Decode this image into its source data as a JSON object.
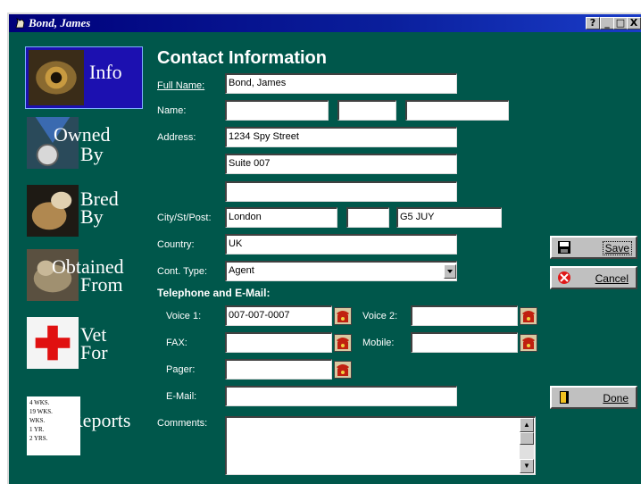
{
  "window": {
    "title": "Bond, James",
    "controls": {
      "help": "?",
      "minimize": "_",
      "maximize": "□",
      "close": "X"
    }
  },
  "sidebar": {
    "items": [
      {
        "line1": "Info",
        "line2": "",
        "icon": "eye-photo",
        "active": true
      },
      {
        "line1": "Owned",
        "line2": "By",
        "icon": "medal-photo",
        "active": false
      },
      {
        "line1": "Bred",
        "line2": "By",
        "icon": "puppy-photo",
        "active": false
      },
      {
        "line1": "Obtained",
        "line2": "From",
        "icon": "puppy-photo",
        "active": false
      },
      {
        "line1": "Vet",
        "line2": "For",
        "icon": "red-cross-icon",
        "active": false
      },
      {
        "line1": "Reports",
        "line2": "",
        "icon": "report-sheet",
        "active": false
      }
    ],
    "report_sheet": [
      "4 WKS.",
      "19 WKS.",
      "WKS.",
      "1 YR.",
      "2 YRS."
    ]
  },
  "form": {
    "title": "Contact Information",
    "full_name": {
      "label": "Full Name:",
      "value": "Bond, James"
    },
    "name": {
      "label": "Name:",
      "first": "",
      "middle": "",
      "last": ""
    },
    "address": {
      "label": "Address:",
      "line1": "1234 Spy Street",
      "line2": "Suite 007",
      "line3": ""
    },
    "city_st_post": {
      "label": "City/St/Post:",
      "city": "London",
      "state": "",
      "postal": "G5 JUY"
    },
    "country": {
      "label": "Country:",
      "value": "UK"
    },
    "cont_type": {
      "label": "Cont. Type:",
      "value": "Agent"
    },
    "telephone_heading": "Telephone and E-Mail:",
    "voice1": {
      "label": "Voice 1:",
      "value": "007-007-0007"
    },
    "voice2": {
      "label": "Voice 2:",
      "value": ""
    },
    "fax": {
      "label": "FAX:",
      "value": ""
    },
    "mobile": {
      "label": "Mobile:",
      "value": ""
    },
    "pager": {
      "label": "Pager:",
      "value": ""
    },
    "email": {
      "label": "E-Mail:",
      "value": ""
    },
    "comments": {
      "label": "Comments:",
      "value": ""
    }
  },
  "buttons": {
    "save": "Save",
    "cancel": "Cancel",
    "done": "Done"
  },
  "colors": {
    "background": "#00574b",
    "title_bar": "#00007a",
    "active_nav": "#1c10b0"
  }
}
